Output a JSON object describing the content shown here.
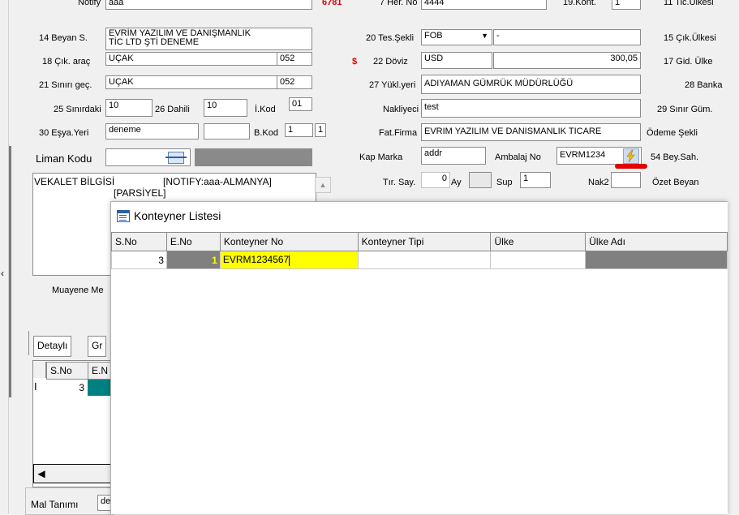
{
  "form": {
    "notify_label": "Notify",
    "notify_value": "aaa",
    "notify_red": "6781",
    "beyan_label": "14 Beyan S.",
    "beyan_value_line1": "EVRİM YAZILIM VE DANIŞMANLIK",
    "beyan_value_line2": "TİC LTD ŞTİ   DENEME",
    "cik_arac_label": "18 Çık. araç",
    "cik_arac_value": "UÇAK",
    "cik_arac_code": "052",
    "sinir_gec_label": "21 Sınırı geç.",
    "sinir_gec_value": "UÇAK",
    "sinir_gec_code": "052",
    "sinirdaki_label": "25 Sınırdaki",
    "sinirdaki_value": "10",
    "dahili_label": "26 Dahili",
    "dahili_value": "10",
    "ikod_label": "İ.Kod",
    "ikod_value": "01",
    "esya_yeri_label": "30 Eşya.Yeri",
    "esya_yeri_value": "deneme",
    "bkod_label": "B.Kod",
    "bkod_value1": "1",
    "bkod_value2": "1",
    "liman_label": "Liman Kodu",
    "vekalet_text": "VEKALET BİLGİSİ",
    "notify_tag": "[NOTIFY:aaa-ALMANYA]",
    "parsiyel": "[PARSİYEL]",
    "muayene_label": "Muayene Me",
    "her_no_label": "7 Her. No",
    "her_no_value": "4444",
    "tes_sekli_label": "20 Tes.Şekli",
    "tes_sekli_value": "FOB",
    "tes_sekli_extra": "-",
    "doviz_label": "22 Döviz",
    "doviz_value": "USD",
    "doviz_amount": "300,05",
    "dollar_sign": "$",
    "yukl_yeri_label": "27 Yükl.yeri",
    "yukl_yeri_value": "ADIYAMAN GÜMRÜK MÜDÜRLÜĞÜ",
    "nakliyeci_label": "Nakliyeci",
    "nakliyeci_value": "test",
    "fat_firma_label": "Fat.Firma",
    "fat_firma_value": "EVRIM YAZILIM VE DANISMANLIK TICARE",
    "kap_marka_label": "Kap Marka",
    "kap_marka_value": "addr",
    "ambalaj_label": "Ambalaj No",
    "ambalaj_value": "EVRM1234",
    "tir_say_label": "Tır. Say.",
    "tir_say_value": "0",
    "ay_label": "Ay",
    "sup_label": "Sup",
    "sup_value": "1",
    "nak2_label": "Nak2",
    "right_labels": [
      "19.Kont.",
      "11 Tic.Ülkesi",
      "15 Çık.Ülkesi",
      "17 Gid. Ülke",
      "28 Banka",
      "29 Sınır Güm.",
      "Ödeme Şekli",
      "54 Bey.Sah.",
      "Özet Beyan"
    ],
    "konteyner_flag": "1"
  },
  "bottom": {
    "tab_detayli": "Detaylı",
    "tab_gr": "Gr",
    "grid_headers": [
      "S.No",
      "E.N"
    ],
    "grid_row": {
      "sno": "3",
      "cursor": "I"
    },
    "mal_tanimi_label": "Mal Tanımı",
    "mal_tanimi_value": "de"
  },
  "dialog": {
    "title": "Konteyner Listesi",
    "columns": [
      "S.No",
      "E.No",
      "Konteyner No",
      "Konteyner Tipi",
      "Ülke",
      "Ülke Adı"
    ],
    "rows": [
      {
        "sno": "3",
        "eno": "1",
        "konteyner_no": "EVRM1234567",
        "tipi": "",
        "ulke": "",
        "ulke_adi": ""
      }
    ]
  },
  "colors": {
    "highlight": "#ffff00",
    "teal": "#008080",
    "red_mark": "#e00000",
    "dark_cell": "#808080"
  }
}
